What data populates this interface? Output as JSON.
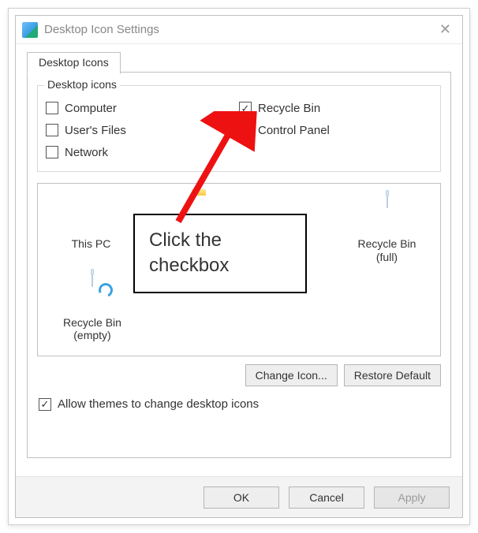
{
  "window": {
    "title": "Desktop Icon Settings",
    "close_glyph": "✕"
  },
  "tab": {
    "label": "Desktop Icons"
  },
  "group": {
    "title": "Desktop icons",
    "left": [
      {
        "label": "Computer",
        "checked": false
      },
      {
        "label": "User's Files",
        "checked": false
      },
      {
        "label": "Network",
        "checked": false
      }
    ],
    "right": [
      {
        "label": "Recycle Bin",
        "checked": true
      },
      {
        "label": "Control Panel",
        "checked": false
      }
    ]
  },
  "icons": {
    "row1": [
      {
        "label": "This PC"
      },
      {
        "label": ""
      },
      {
        "label": ""
      },
      {
        "label_line1": "Recycle Bin",
        "label_line2": "(full)"
      }
    ],
    "row2": [
      {
        "label_line1": "Recycle Bin",
        "label_line2": "(empty)"
      }
    ]
  },
  "buttons": {
    "change_icon": "Change Icon...",
    "restore_default": "Restore Default",
    "ok": "OK",
    "cancel": "Cancel",
    "apply": "Apply"
  },
  "allow_themes": {
    "label": "Allow themes to change desktop icons",
    "checked": true
  },
  "annotation": {
    "text": "Click the checkbox"
  }
}
